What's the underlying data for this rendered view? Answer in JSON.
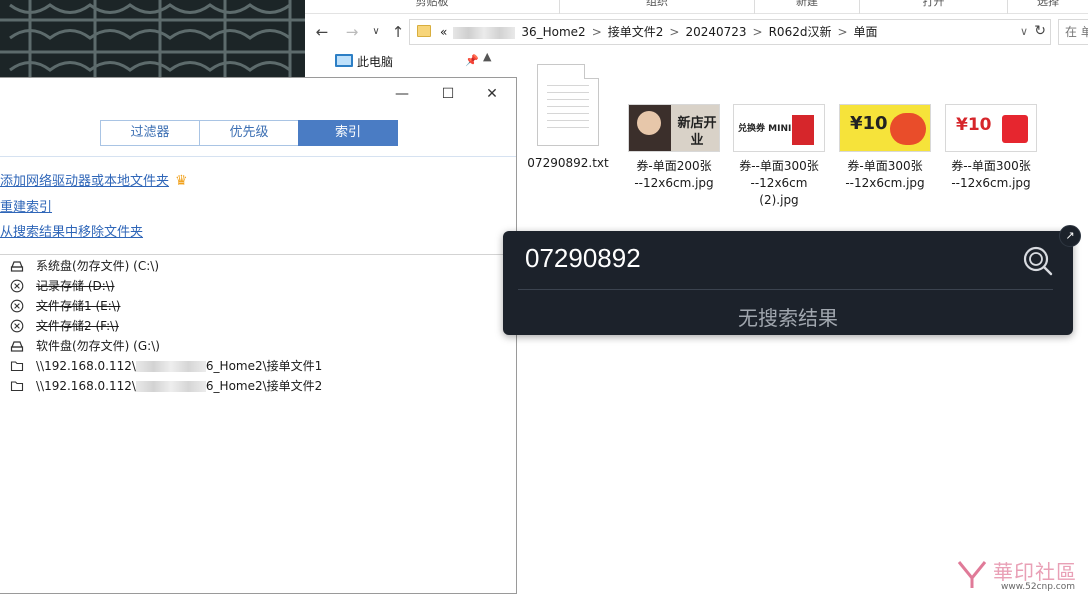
{
  "ribbon": {
    "groups": [
      "剪贴板",
      "组织",
      "新建",
      "打开",
      "选择"
    ]
  },
  "explorer": {
    "address": {
      "lead": "«",
      "crumbs": [
        "36_Home2",
        "接单文件2",
        "20240723",
        "R062d汉新",
        "单面"
      ],
      "separator": ">"
    },
    "search_placeholder": "在 单",
    "nav": {
      "this_pc": "此电脑"
    },
    "files": [
      {
        "name": "07290892.txt",
        "kind": "txt"
      },
      {
        "name": "券-单面200张\n--12x6cm.jpg",
        "kind": "jpg",
        "thumb_text": "新店开业 ¥19.9"
      },
      {
        "name": "券--单面300张\n--12x6cm\n(2).jpg",
        "kind": "jpg",
        "thumb_text": "兑换券 MINI"
      },
      {
        "name": "券-单面300张\n--12x6cm.jpg",
        "kind": "jpg",
        "thumb_text": "¥10"
      },
      {
        "name": "券--单面300张\n--12x6cm.jpg",
        "kind": "jpg",
        "thumb_text": "¥10"
      }
    ]
  },
  "dialog": {
    "tabs": [
      "过滤器",
      "优先级",
      "索引"
    ],
    "active_tab": "索引",
    "links": {
      "add": "添加网络驱动器或本地文件夹",
      "rebuild": "重建索引",
      "remove": "从搜索结果中移除文件夹"
    },
    "drives": [
      {
        "label": "系统盘(勿存文件) (C:\\)",
        "icon": "drive-icon",
        "disabled": false
      },
      {
        "label": "记录存储 (D:\\)",
        "icon": "disabled-x-icon",
        "disabled": true
      },
      {
        "label": "文件存储1 (E:\\)",
        "icon": "disabled-x-icon",
        "disabled": true
      },
      {
        "label": "文件存储2 (F:\\)",
        "icon": "disabled-x-icon",
        "disabled": true
      },
      {
        "label": "软件盘(勿存文件) (G:\\)",
        "icon": "drive-icon",
        "disabled": false
      },
      {
        "label_pre": "\\\\192.168.0.112\\",
        "label_post": "6_Home2\\接单文件1",
        "icon": "folder-icon",
        "disabled": false
      },
      {
        "label_pre": "\\\\192.168.0.112\\",
        "label_post": "6_Home2\\接单文件2",
        "icon": "folder-icon",
        "disabled": false
      }
    ]
  },
  "popup": {
    "query": "07290892",
    "no_results": "无搜索结果"
  },
  "watermark": {
    "brand": "華印社區",
    "url": "www.52cnp.com"
  },
  "colors": {
    "accent": "#4a7cc4",
    "link": "#2f66b8",
    "popup_bg": "#1c222b"
  }
}
